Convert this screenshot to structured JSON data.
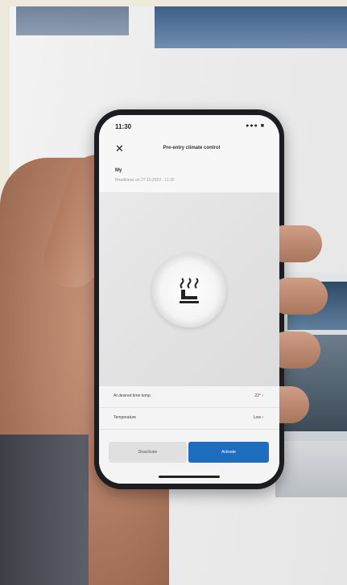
{
  "status_bar": {
    "time": "11:30",
    "signal": "●●● ■"
  },
  "header": {
    "title": "Pre-entry climate control",
    "close_icon": "close-icon"
  },
  "vehicle": {
    "name": "My",
    "subtitle": "Readiness on 27.10.2023 · 11:30"
  },
  "feature": {
    "icon": "seat-heat-icon"
  },
  "settings": [
    {
      "label": "At desired time temp",
      "value": "22° ›"
    },
    {
      "label": "Temperature",
      "value": "Low ›"
    }
  ],
  "actions": {
    "deactivate": "Deactivate",
    "activate": "Activate"
  },
  "colors": {
    "accent": "#1f6dbf",
    "background": "#ede9dc"
  }
}
